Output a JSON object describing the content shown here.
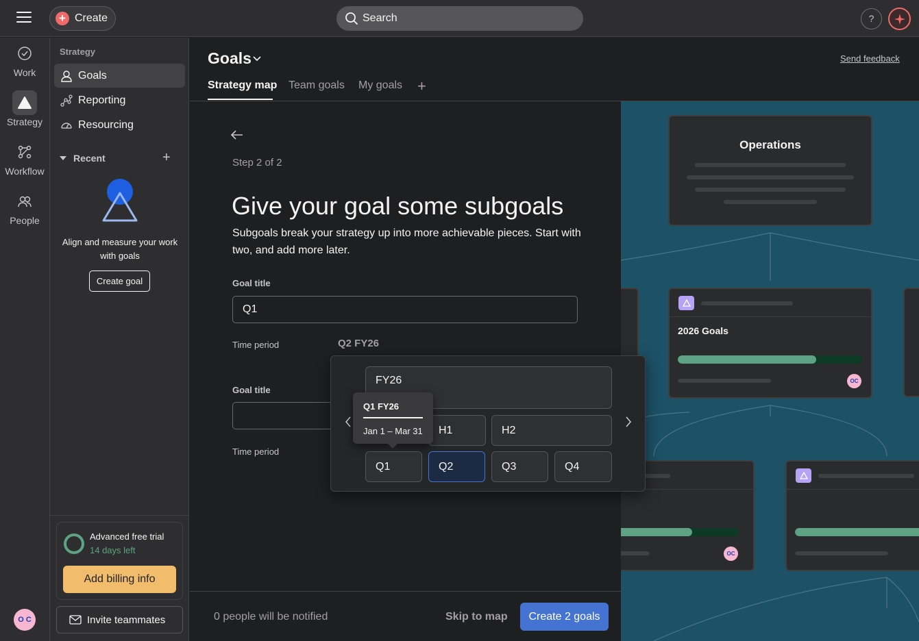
{
  "topbar": {
    "create_label": "Create",
    "search_label": "Search",
    "help_label": "?"
  },
  "rail": {
    "items": [
      {
        "label": "Work",
        "icon": "check-circle-icon"
      },
      {
        "label": "Strategy",
        "icon": "triangle-icon"
      },
      {
        "label": "Workflow",
        "icon": "workflow-icon"
      },
      {
        "label": "People",
        "icon": "people-icon"
      }
    ],
    "avatar_initials": "O C"
  },
  "sidebar": {
    "section": "Strategy",
    "items": [
      {
        "label": "Goals",
        "icon": "person-icon"
      },
      {
        "label": "Reporting",
        "icon": "reporting-icon"
      },
      {
        "label": "Resourcing",
        "icon": "gauge-icon"
      }
    ],
    "recent_label": "Recent",
    "empty_text": "Align and measure your work with goals",
    "create_goal_label": "Create goal",
    "trial": {
      "title": "Advanced free trial",
      "days": "14 days left",
      "billing_label": "Add billing info"
    },
    "invite_label": "Invite teammates"
  },
  "header": {
    "title": "Goals",
    "feedback": "Send feedback",
    "tabs": [
      {
        "label": "Strategy map"
      },
      {
        "label": "Team goals"
      },
      {
        "label": "My goals"
      }
    ]
  },
  "form": {
    "step": "Step 2 of 2",
    "heading": "Give your goal some subgoals",
    "subtext": "Subgoals break your strategy up into more achievable pieces. Start with two, and add more later.",
    "goal1": {
      "title_label": "Goal title",
      "value": "Q1",
      "time_label": "Time period",
      "time_value": "Q2 FY26"
    },
    "goal2": {
      "title_label": "Goal title",
      "value": "",
      "time_label": "Time period"
    },
    "notify": "0 people will be notified",
    "skip_label": "Skip to map",
    "create_label": "Create 2 goals"
  },
  "picker": {
    "year": "FY26",
    "halves": [
      "H1",
      "H2"
    ],
    "quarters": [
      "Q1",
      "Q2",
      "Q3",
      "Q4"
    ],
    "selected": "Q2",
    "tooltip": {
      "title": "Q1 FY26",
      "range": "Jan 1 – Mar 31"
    }
  },
  "map": {
    "top_card": "Operations",
    "goal_card": "2026 Goals",
    "goal_progress": 0.75,
    "left_progress": 0.62,
    "right_progress": 1.0,
    "colors": {
      "background": "#1d5166",
      "progress": "#5da283",
      "accent": "#4573d2"
    }
  }
}
